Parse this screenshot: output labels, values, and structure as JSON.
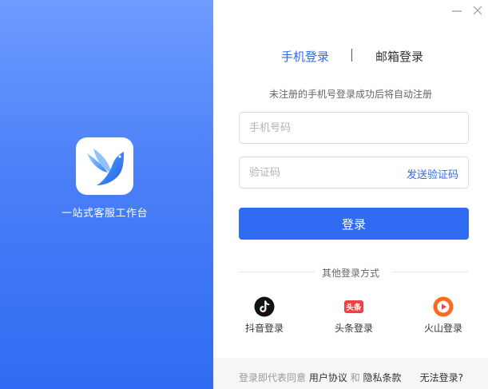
{
  "app": {
    "name": "一站式客服工作台",
    "logo_icon": "bird-logo-icon",
    "brand_color": "#2f6cf3"
  },
  "window": {
    "minimize_icon": "minimize-icon",
    "close_icon": "close-icon"
  },
  "tabs": [
    {
      "label": "手机登录",
      "active": true
    },
    {
      "label": "邮箱登录",
      "active": false
    }
  ],
  "hint": "未注册的手机号登录成功后将自动注册",
  "form": {
    "phone_placeholder": "手机号码",
    "code_placeholder": "验证码",
    "send_code_label": "发送验证码",
    "login_label": "登录"
  },
  "other_login": {
    "title": "其他登录方式",
    "options": [
      {
        "label": "抖音登录",
        "icon": "douyin-icon",
        "color": "#000000"
      },
      {
        "label": "头条登录",
        "icon": "toutiao-icon",
        "color": "#f04142",
        "icon_text": "头条"
      },
      {
        "label": "火山登录",
        "icon": "huoshan-icon",
        "color": "#ff6a1f"
      }
    ]
  },
  "footer": {
    "prefix": "登录即代表同意",
    "agreement": "用户协议",
    "and": "和",
    "privacy": "隐私条款",
    "help": "无法登录?"
  }
}
